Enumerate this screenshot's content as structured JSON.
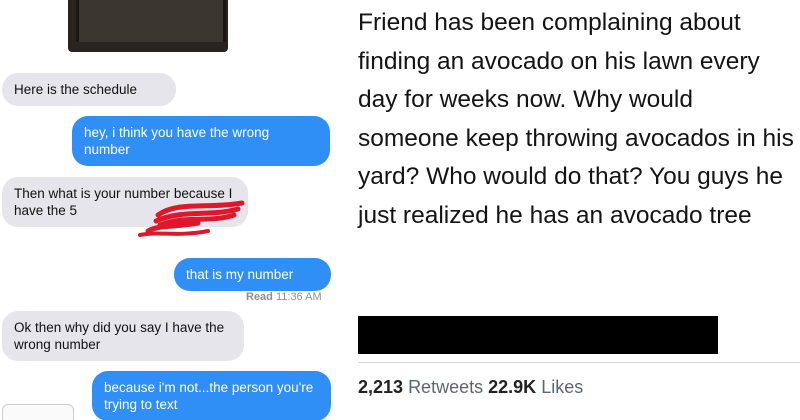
{
  "messages": [
    {
      "text": "Here is the schedule"
    },
    {
      "text": "hey, i think you have the wrong number"
    },
    {
      "text": "Then what is your number because I have the 5"
    },
    {
      "text": "that is my number"
    },
    {
      "text": "Ok then why did you say I have the wrong number"
    },
    {
      "text": "because i'm not...the person you're trying to text"
    }
  ],
  "read_receipt": {
    "label": "Read",
    "time": "11:36 AM"
  },
  "colors": {
    "sent_bubble": "#2f8ff7",
    "received_bubble": "#e6e5eb",
    "redaction": "#e0162b"
  },
  "tweet": {
    "text": "Friend has been complaining about finding an avocado on his lawn every day for weeks now. Why would someone keep throwing avocados in his yard? Who would do that? You guys he just realized he has an avocado tree",
    "retweets_count": "2,213",
    "retweets_label": "Retweets",
    "likes_count": "22.9K",
    "likes_label": "Likes"
  }
}
